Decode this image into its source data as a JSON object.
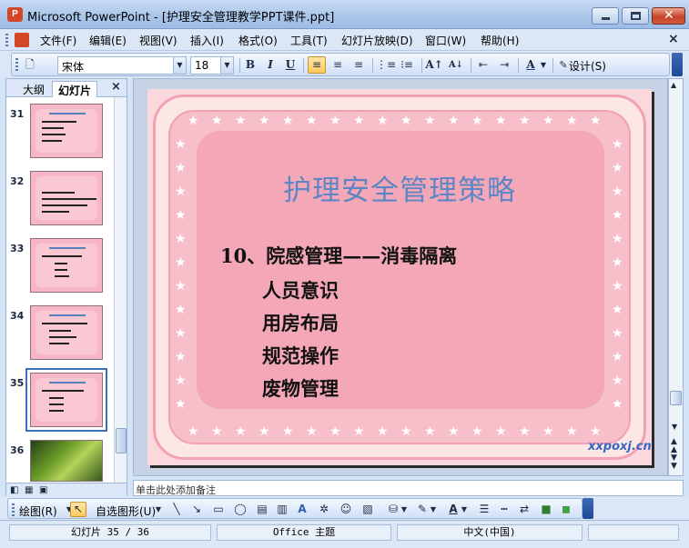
{
  "window": {
    "title": "Microsoft PowerPoint - [护理安全管理教学PPT课件.ppt]",
    "app_icon": "powerpoint-icon",
    "minimize_icon": "minimize-icon",
    "maximize_icon": "maximize-icon",
    "close_icon": "close-icon"
  },
  "menu": {
    "items": [
      "文件(F)",
      "编辑(E)",
      "视图(V)",
      "插入(I)",
      "格式(O)",
      "工具(T)",
      "幻灯片放映(D)",
      "窗口(W)",
      "帮助(H)"
    ],
    "close_glyph": "×"
  },
  "format_toolbar": {
    "font_name": "宋体",
    "font_size": "18",
    "bold": "B",
    "italic": "I",
    "underline": "U",
    "font_color_glyph": "A",
    "design_label": "设计(S)"
  },
  "panel": {
    "tab_outline": "大纲",
    "tab_slides": "幻灯片",
    "close_glyph": "×",
    "thumbnails": [
      {
        "number": "31"
      },
      {
        "number": "32"
      },
      {
        "number": "33"
      },
      {
        "number": "34"
      },
      {
        "number": "35"
      },
      {
        "number": "36"
      }
    ],
    "selected": "35"
  },
  "slide": {
    "title": "护理安全管理策略",
    "lines": [
      "10、院感管理——消毒隔离",
      "人员意识",
      "用房布局",
      "规范操作",
      "废物管理"
    ],
    "watermark": "xxpoxj.cn"
  },
  "notes": {
    "text": "单击此处添加备注"
  },
  "draw_toolbar": {
    "draw_label": "绘图(R)",
    "autoshape_label": "自选图形(U)"
  },
  "status": {
    "slide_indicator": "幻灯片 35 / 36",
    "theme": "Office 主题",
    "language": "中文(中国)"
  },
  "colors": {
    "slide_title": "#5c86c5",
    "slide_panel": "#f4a7b7",
    "slide_frame": "#fde7e2",
    "accent": "#3e6eb8"
  }
}
